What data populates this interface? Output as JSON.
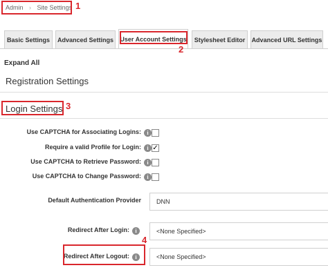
{
  "breadcrumb": {
    "root": "Admin",
    "separator": "›",
    "current": "Site Settings"
  },
  "tabs": [
    {
      "label": "Basic Settings"
    },
    {
      "label": "Advanced Settings"
    },
    {
      "label": "User Account Settings"
    },
    {
      "label": "Stylesheet Editor"
    },
    {
      "label": "Advanced URL Settings"
    }
  ],
  "expand_all": "Expand All",
  "sections": {
    "registration": "Registration Settings",
    "login": "Login Settings"
  },
  "login": {
    "captcha_associating": {
      "label": "Use CAPTCHA for Associating Logins:",
      "checked": false
    },
    "require_profile": {
      "label": "Require a valid Profile for Login:",
      "checked": true
    },
    "captcha_retrieve": {
      "label": "Use CAPTCHA to Retrieve Password:",
      "checked": false
    },
    "captcha_change": {
      "label": "Use CAPTCHA to Change Password:",
      "checked": false
    },
    "default_auth": {
      "label": "Default Authentication Provider",
      "value": "DNN"
    },
    "redirect_login": {
      "label": "Redirect After Login:",
      "value": "<None Specified>"
    },
    "redirect_logout": {
      "label": "Redirect After Logout:",
      "value": "<None Specified>"
    }
  },
  "annotations": [
    "1",
    "2",
    "3",
    "4"
  ],
  "colors": {
    "annotation": "#d9262c",
    "tab_bg": "#ececec",
    "border": "#cfcfcf"
  },
  "icons": {
    "info": "i",
    "check": "✓"
  }
}
